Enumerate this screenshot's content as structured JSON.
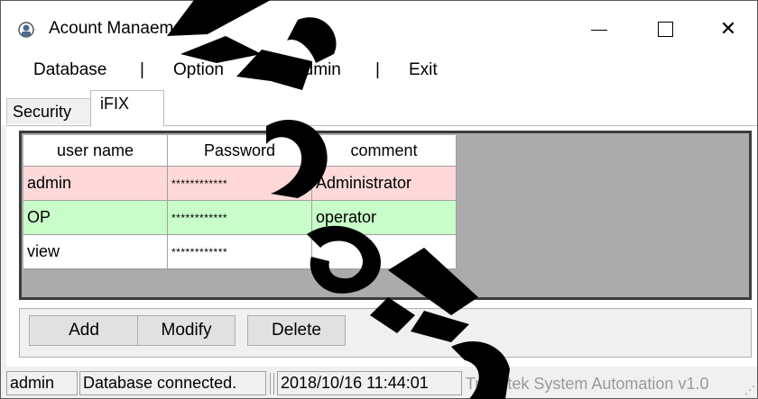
{
  "window": {
    "title": "Acount Manaement",
    "controls": {
      "minimize": "—",
      "maximize": "☐",
      "close": "✕"
    }
  },
  "menu": {
    "items": [
      "Database",
      "Option",
      "Admin",
      "Exit"
    ],
    "separator": "|"
  },
  "tabs": [
    {
      "label": "Security",
      "active": false
    },
    {
      "label": "iFIX",
      "active": true
    }
  ],
  "grid": {
    "columns": [
      "user name",
      "Password",
      "comment"
    ],
    "rows": [
      {
        "user": "admin",
        "password": "************",
        "comment": "Administrator",
        "color": "#ffd9d9"
      },
      {
        "user": "OP",
        "password": "************",
        "comment": "operator",
        "color": "#c8fcc8"
      },
      {
        "user": "view",
        "password": "************",
        "comment": "",
        "color": "#ffffff"
      }
    ]
  },
  "buttons": {
    "add": "Add",
    "modify": "Modify",
    "delete": "Delete"
  },
  "status": {
    "user": "admin",
    "db": "Database connected.",
    "time": "2018/10/16 11:44:01",
    "vendor": "Trendtek System Automation v1.0"
  },
  "colors": {
    "accent_watermark": "#000000",
    "grid_bg": "#ababab"
  }
}
